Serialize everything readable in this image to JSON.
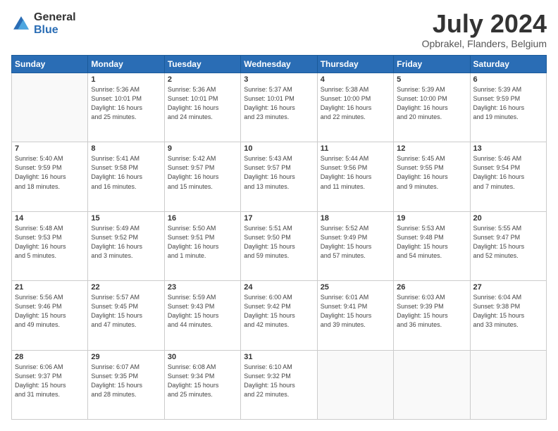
{
  "logo": {
    "general": "General",
    "blue": "Blue"
  },
  "title": "July 2024",
  "subtitle": "Opbrakel, Flanders, Belgium",
  "weekdays": [
    "Sunday",
    "Monday",
    "Tuesday",
    "Wednesday",
    "Thursday",
    "Friday",
    "Saturday"
  ],
  "weeks": [
    [
      {
        "day": "",
        "info": ""
      },
      {
        "day": "1",
        "info": "Sunrise: 5:36 AM\nSunset: 10:01 PM\nDaylight: 16 hours\nand 25 minutes."
      },
      {
        "day": "2",
        "info": "Sunrise: 5:36 AM\nSunset: 10:01 PM\nDaylight: 16 hours\nand 24 minutes."
      },
      {
        "day": "3",
        "info": "Sunrise: 5:37 AM\nSunset: 10:01 PM\nDaylight: 16 hours\nand 23 minutes."
      },
      {
        "day": "4",
        "info": "Sunrise: 5:38 AM\nSunset: 10:00 PM\nDaylight: 16 hours\nand 22 minutes."
      },
      {
        "day": "5",
        "info": "Sunrise: 5:39 AM\nSunset: 10:00 PM\nDaylight: 16 hours\nand 20 minutes."
      },
      {
        "day": "6",
        "info": "Sunrise: 5:39 AM\nSunset: 9:59 PM\nDaylight: 16 hours\nand 19 minutes."
      }
    ],
    [
      {
        "day": "7",
        "info": "Sunrise: 5:40 AM\nSunset: 9:59 PM\nDaylight: 16 hours\nand 18 minutes."
      },
      {
        "day": "8",
        "info": "Sunrise: 5:41 AM\nSunset: 9:58 PM\nDaylight: 16 hours\nand 16 minutes."
      },
      {
        "day": "9",
        "info": "Sunrise: 5:42 AM\nSunset: 9:57 PM\nDaylight: 16 hours\nand 15 minutes."
      },
      {
        "day": "10",
        "info": "Sunrise: 5:43 AM\nSunset: 9:57 PM\nDaylight: 16 hours\nand 13 minutes."
      },
      {
        "day": "11",
        "info": "Sunrise: 5:44 AM\nSunset: 9:56 PM\nDaylight: 16 hours\nand 11 minutes."
      },
      {
        "day": "12",
        "info": "Sunrise: 5:45 AM\nSunset: 9:55 PM\nDaylight: 16 hours\nand 9 minutes."
      },
      {
        "day": "13",
        "info": "Sunrise: 5:46 AM\nSunset: 9:54 PM\nDaylight: 16 hours\nand 7 minutes."
      }
    ],
    [
      {
        "day": "14",
        "info": "Sunrise: 5:48 AM\nSunset: 9:53 PM\nDaylight: 16 hours\nand 5 minutes."
      },
      {
        "day": "15",
        "info": "Sunrise: 5:49 AM\nSunset: 9:52 PM\nDaylight: 16 hours\nand 3 minutes."
      },
      {
        "day": "16",
        "info": "Sunrise: 5:50 AM\nSunset: 9:51 PM\nDaylight: 16 hours\nand 1 minute."
      },
      {
        "day": "17",
        "info": "Sunrise: 5:51 AM\nSunset: 9:50 PM\nDaylight: 15 hours\nand 59 minutes."
      },
      {
        "day": "18",
        "info": "Sunrise: 5:52 AM\nSunset: 9:49 PM\nDaylight: 15 hours\nand 57 minutes."
      },
      {
        "day": "19",
        "info": "Sunrise: 5:53 AM\nSunset: 9:48 PM\nDaylight: 15 hours\nand 54 minutes."
      },
      {
        "day": "20",
        "info": "Sunrise: 5:55 AM\nSunset: 9:47 PM\nDaylight: 15 hours\nand 52 minutes."
      }
    ],
    [
      {
        "day": "21",
        "info": "Sunrise: 5:56 AM\nSunset: 9:46 PM\nDaylight: 15 hours\nand 49 minutes."
      },
      {
        "day": "22",
        "info": "Sunrise: 5:57 AM\nSunset: 9:45 PM\nDaylight: 15 hours\nand 47 minutes."
      },
      {
        "day": "23",
        "info": "Sunrise: 5:59 AM\nSunset: 9:43 PM\nDaylight: 15 hours\nand 44 minutes."
      },
      {
        "day": "24",
        "info": "Sunrise: 6:00 AM\nSunset: 9:42 PM\nDaylight: 15 hours\nand 42 minutes."
      },
      {
        "day": "25",
        "info": "Sunrise: 6:01 AM\nSunset: 9:41 PM\nDaylight: 15 hours\nand 39 minutes."
      },
      {
        "day": "26",
        "info": "Sunrise: 6:03 AM\nSunset: 9:39 PM\nDaylight: 15 hours\nand 36 minutes."
      },
      {
        "day": "27",
        "info": "Sunrise: 6:04 AM\nSunset: 9:38 PM\nDaylight: 15 hours\nand 33 minutes."
      }
    ],
    [
      {
        "day": "28",
        "info": "Sunrise: 6:06 AM\nSunset: 9:37 PM\nDaylight: 15 hours\nand 31 minutes."
      },
      {
        "day": "29",
        "info": "Sunrise: 6:07 AM\nSunset: 9:35 PM\nDaylight: 15 hours\nand 28 minutes."
      },
      {
        "day": "30",
        "info": "Sunrise: 6:08 AM\nSunset: 9:34 PM\nDaylight: 15 hours\nand 25 minutes."
      },
      {
        "day": "31",
        "info": "Sunrise: 6:10 AM\nSunset: 9:32 PM\nDaylight: 15 hours\nand 22 minutes."
      },
      {
        "day": "",
        "info": ""
      },
      {
        "day": "",
        "info": ""
      },
      {
        "day": "",
        "info": ""
      }
    ]
  ]
}
